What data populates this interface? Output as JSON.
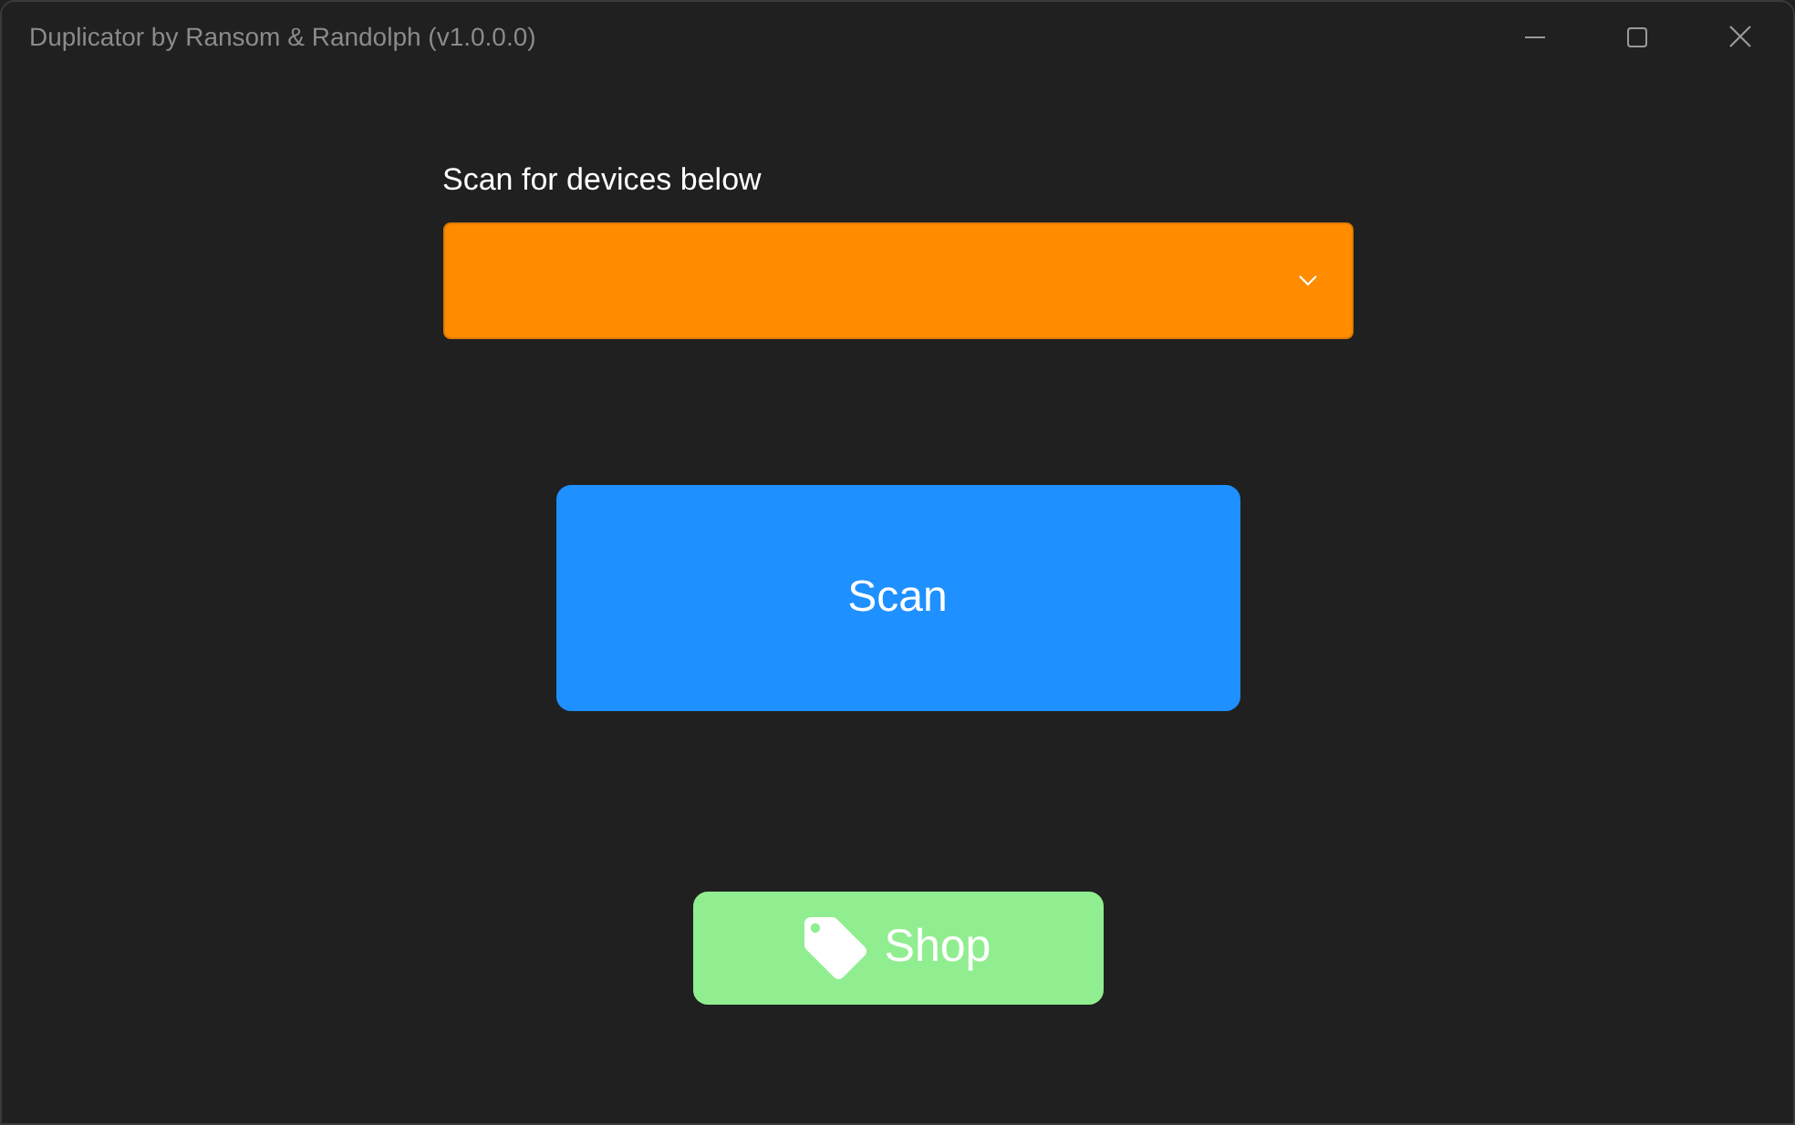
{
  "window": {
    "title": "Duplicator by Ransom & Randolph (v1.0.0.0)"
  },
  "device_picker": {
    "label": "Scan for devices below"
  },
  "scan_button": {
    "label": "Scan"
  },
  "shop_button": {
    "label": "Shop"
  }
}
